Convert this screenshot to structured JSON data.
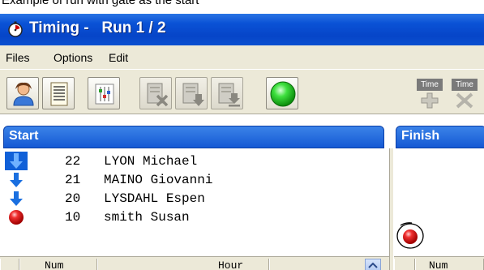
{
  "caption": "Example of run with gate as the start",
  "window": {
    "title": "Timing -   Run 1 / 2"
  },
  "menu": {
    "files": "Files",
    "options": "Options",
    "edit": "Edit"
  },
  "toolbar": {
    "time_add_label": "Time",
    "time_delete_label": "Time",
    "status_color": "#22cc22"
  },
  "start_panel": {
    "title": "Start",
    "rows": [
      {
        "icon": "down-arrow-icon",
        "number": "22",
        "name": "LYON Michael",
        "selected": true
      },
      {
        "icon": "down-arrow-icon",
        "number": "21",
        "name": "MAINO Giovanni",
        "selected": false
      },
      {
        "icon": "down-arrow-icon",
        "number": "20",
        "name": "LYSDAHL Espen",
        "selected": false
      },
      {
        "icon": "red-dot-icon",
        "number": "10",
        "name": "smith Susan",
        "selected": false
      }
    ]
  },
  "finish_panel": {
    "title": "Finish"
  },
  "table": {
    "start_columns": {
      "num": "Num",
      "hour": "Hour"
    },
    "finish_columns": {
      "num": "Num"
    }
  },
  "colors": {
    "titlebar": "#0a52d6",
    "selection": "#1060d8",
    "red_dot": "#e02020"
  }
}
